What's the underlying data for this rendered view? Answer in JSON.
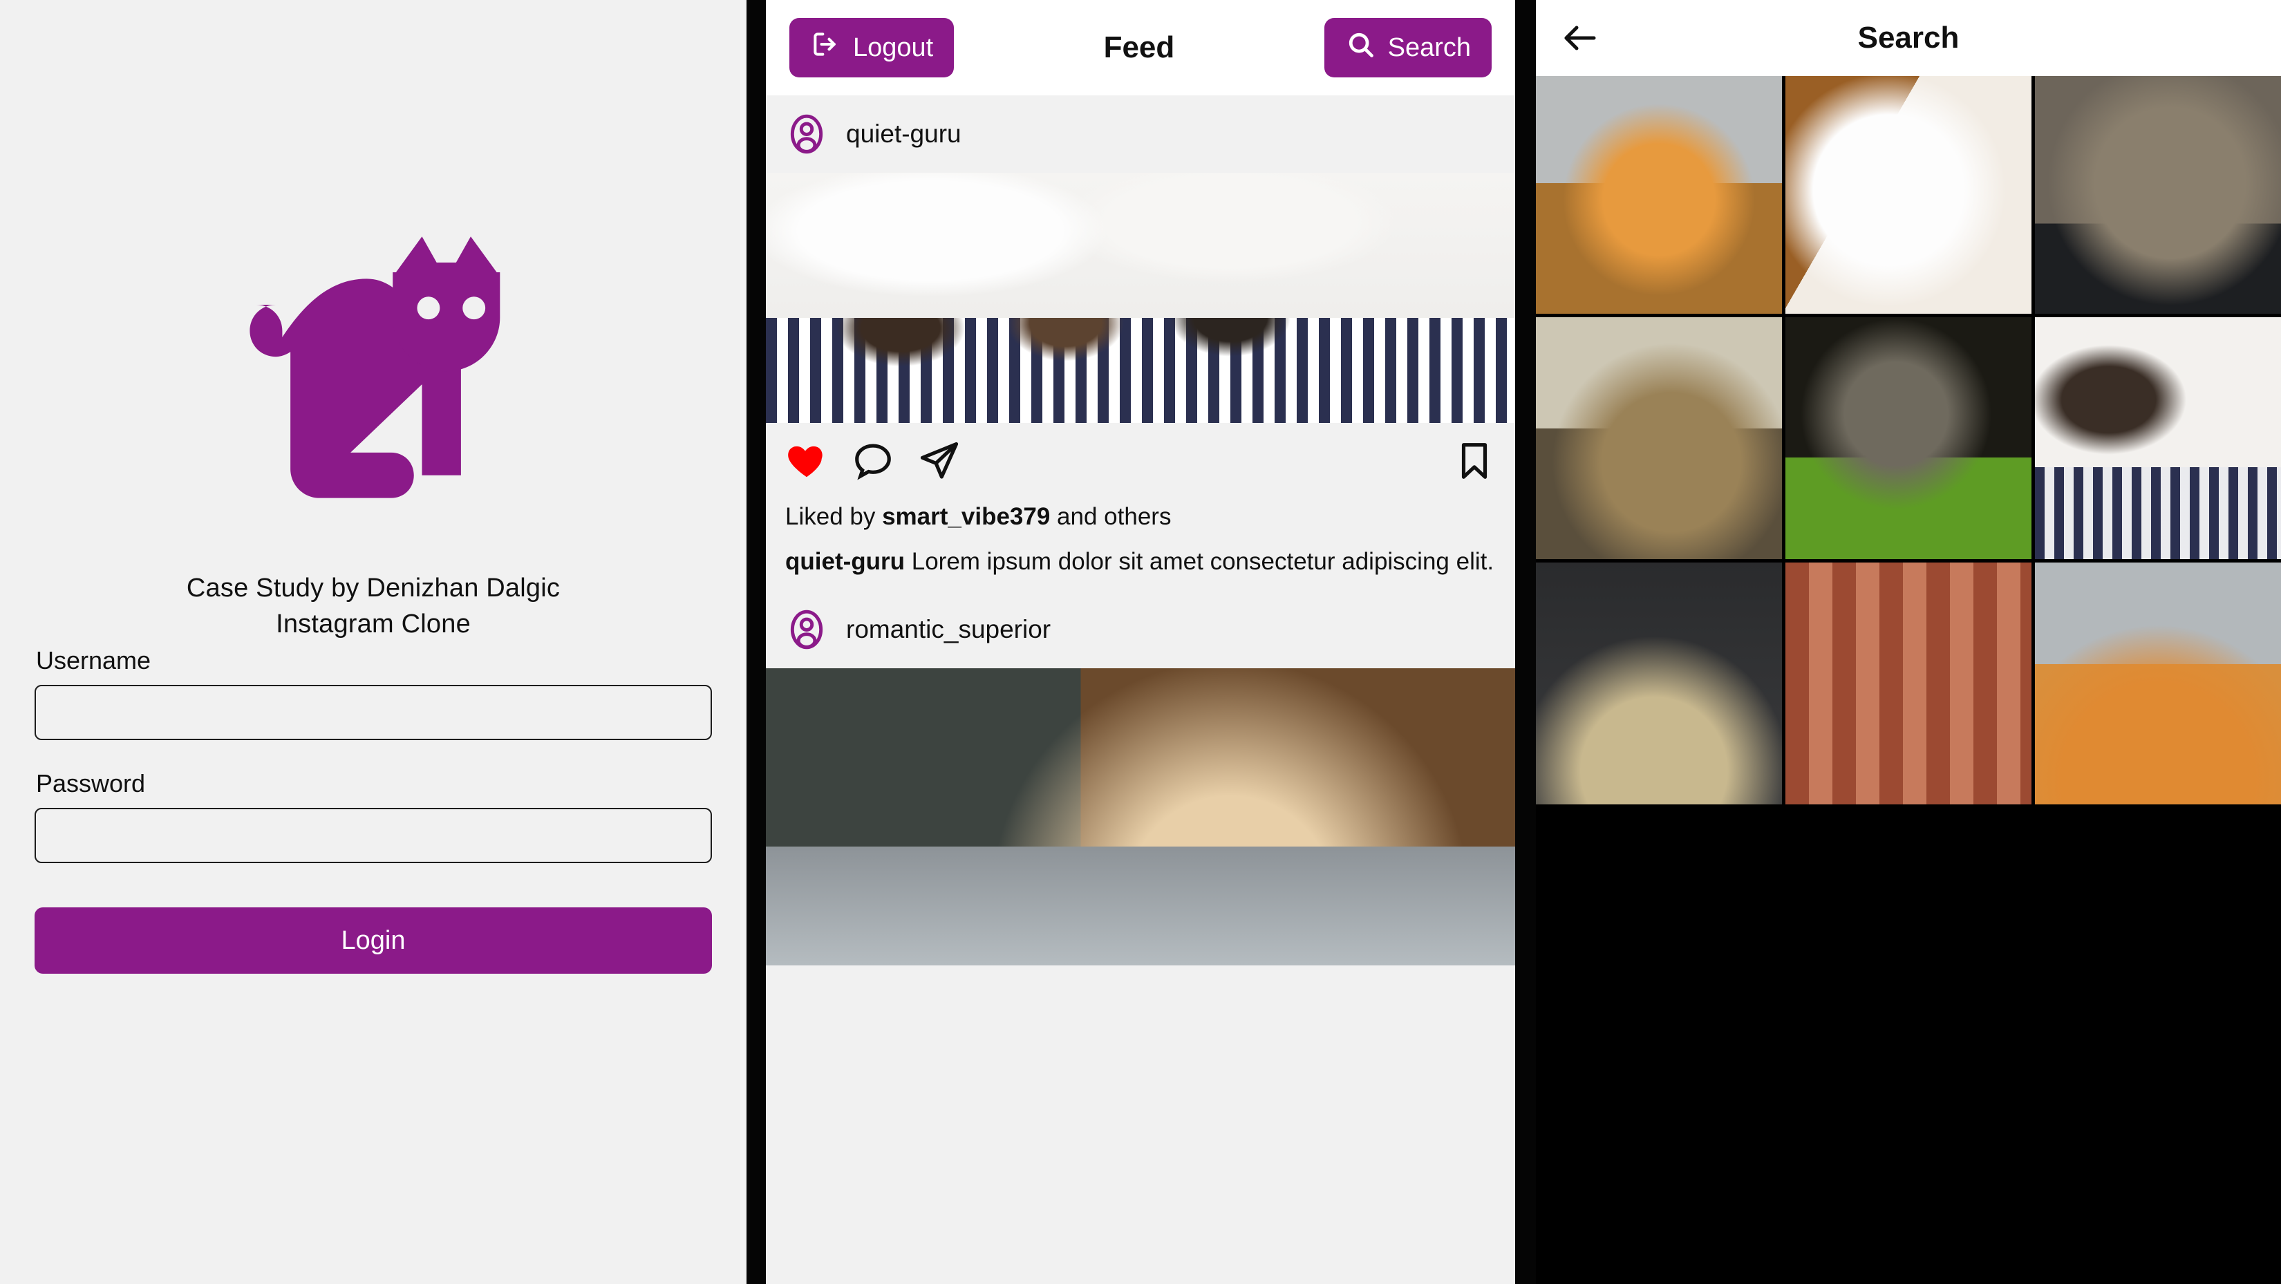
{
  "theme": {
    "accent": "#8b1a89",
    "page_bg": "#f1f1f1",
    "bar_bg": "#ffffff",
    "heart": "#ff0000",
    "divider": "#050505"
  },
  "login": {
    "logo_icon": "cat-logo-icon",
    "brand_line1": "Case Study by Denizhan Dalgic",
    "brand_line2": "Instagram Clone",
    "username_label": "Username",
    "username_value": "",
    "username_placeholder": "",
    "password_label": "Password",
    "password_value": "",
    "password_placeholder": "",
    "login_label": "Login"
  },
  "feed": {
    "logout_label": "Logout",
    "logout_icon": "logout-icon",
    "title": "Feed",
    "search_label": "Search",
    "search_icon": "search-icon",
    "posts": [
      {
        "username": "quiet-guru",
        "avatar_icon": "account-circle-icon",
        "image_alt": "puppies nursing on a checkered blanket",
        "like_icon": "heart-filled-icon",
        "comment_icon": "comment-icon",
        "share_icon": "share-icon",
        "save_icon": "bookmark-icon",
        "liked_prefix": "Liked by ",
        "liked_user": "smart_vibe379",
        "liked_suffix": " and others",
        "caption_user": "quiet-guru",
        "caption_text": " Lorem ipsum dolor sit amet consectetur adipiscing elit."
      },
      {
        "username": "romantic_superior",
        "avatar_icon": "account-circle-icon",
        "image_alt": "cream kitten close-up"
      }
    ]
  },
  "search": {
    "back_icon": "arrow-back-icon",
    "title": "Search",
    "grid": [
      {
        "alt": "ginger tabby cat resting on wooden chair"
      },
      {
        "alt": "white cat peeking"
      },
      {
        "alt": "grey tabby cat with green eyes"
      },
      {
        "alt": "kittens huddled by a stone wall"
      },
      {
        "alt": "tabby cat standing in green grass"
      },
      {
        "alt": "puppies nursing on checkered blanket"
      },
      {
        "alt": "tabby kitten face on dark background"
      },
      {
        "alt": "terracotta tiled roof of a house"
      },
      {
        "alt": "orange cat face close-up"
      }
    ]
  }
}
